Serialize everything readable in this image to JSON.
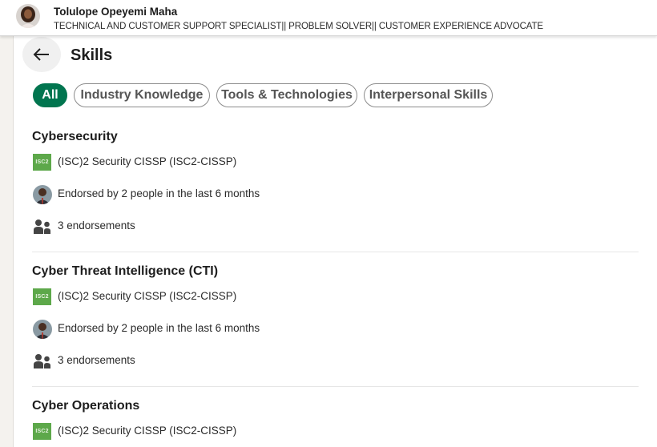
{
  "profile": {
    "name": "Tolulope Opeyemi Maha",
    "headline": "TECHNICAL AND CUSTOMER SUPPORT SPECIALIST|| PROBLEM SOLVER|| CUSTOMER EXPERIENCE ADVOCATE"
  },
  "page": {
    "title": "Skills"
  },
  "filters": [
    {
      "label": "All",
      "active": true
    },
    {
      "label": "Industry Knowledge",
      "active": false
    },
    {
      "label": "Tools & Technologies",
      "active": false
    },
    {
      "label": "Interpersonal Skills",
      "active": false
    }
  ],
  "skills": [
    {
      "name": "Cybersecurity",
      "certification": "(ISC)2 Security CISSP (ISC2-CISSP)",
      "endorsed_by": "Endorsed by 2 people in the last 6 months",
      "endorsements": "3 endorsements"
    },
    {
      "name": "Cyber Threat Intelligence (CTI)",
      "certification": "(ISC)2 Security CISSP (ISC2-CISSP)",
      "endorsed_by": "Endorsed by 2 people in the last 6 months",
      "endorsements": "3 endorsements"
    },
    {
      "name": "Cyber Operations",
      "certification": "(ISC)2 Security CISSP (ISC2-CISSP)"
    }
  ],
  "logo_text": "ISC2",
  "colors": {
    "accent": "#01754f",
    "isc_logo": "#5da84a"
  },
  "icons": {
    "back": "arrow-left-icon",
    "people": "people-icon"
  }
}
